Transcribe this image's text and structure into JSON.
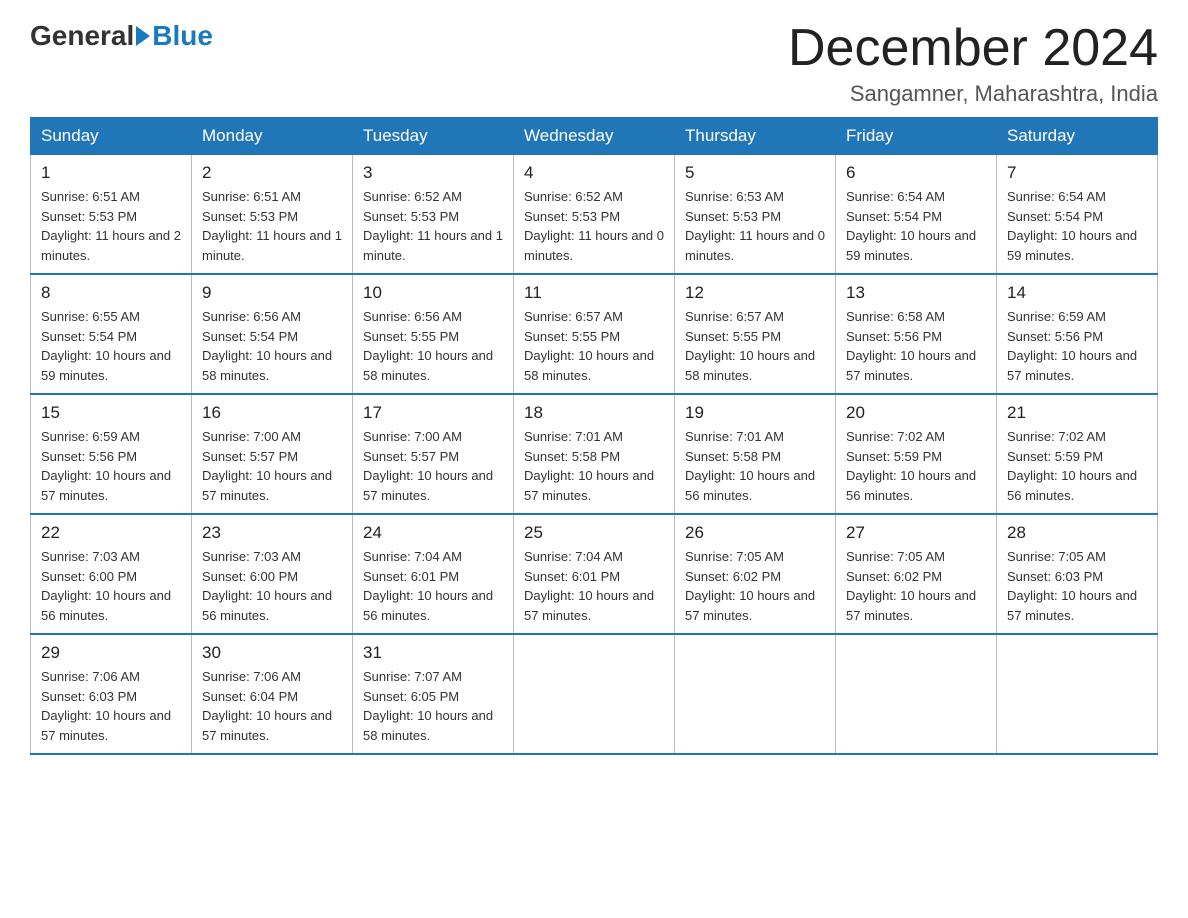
{
  "header": {
    "logo_general": "General",
    "logo_blue": "Blue",
    "month_title": "December 2024",
    "location": "Sangamner, Maharashtra, India"
  },
  "days_of_week": [
    "Sunday",
    "Monday",
    "Tuesday",
    "Wednesday",
    "Thursday",
    "Friday",
    "Saturday"
  ],
  "weeks": [
    [
      {
        "num": "1",
        "sunrise": "6:51 AM",
        "sunset": "5:53 PM",
        "daylight": "11 hours and 2 minutes."
      },
      {
        "num": "2",
        "sunrise": "6:51 AM",
        "sunset": "5:53 PM",
        "daylight": "11 hours and 1 minute."
      },
      {
        "num": "3",
        "sunrise": "6:52 AM",
        "sunset": "5:53 PM",
        "daylight": "11 hours and 1 minute."
      },
      {
        "num": "4",
        "sunrise": "6:52 AM",
        "sunset": "5:53 PM",
        "daylight": "11 hours and 0 minutes."
      },
      {
        "num": "5",
        "sunrise": "6:53 AM",
        "sunset": "5:53 PM",
        "daylight": "11 hours and 0 minutes."
      },
      {
        "num": "6",
        "sunrise": "6:54 AM",
        "sunset": "5:54 PM",
        "daylight": "10 hours and 59 minutes."
      },
      {
        "num": "7",
        "sunrise": "6:54 AM",
        "sunset": "5:54 PM",
        "daylight": "10 hours and 59 minutes."
      }
    ],
    [
      {
        "num": "8",
        "sunrise": "6:55 AM",
        "sunset": "5:54 PM",
        "daylight": "10 hours and 59 minutes."
      },
      {
        "num": "9",
        "sunrise": "6:56 AM",
        "sunset": "5:54 PM",
        "daylight": "10 hours and 58 minutes."
      },
      {
        "num": "10",
        "sunrise": "6:56 AM",
        "sunset": "5:55 PM",
        "daylight": "10 hours and 58 minutes."
      },
      {
        "num": "11",
        "sunrise": "6:57 AM",
        "sunset": "5:55 PM",
        "daylight": "10 hours and 58 minutes."
      },
      {
        "num": "12",
        "sunrise": "6:57 AM",
        "sunset": "5:55 PM",
        "daylight": "10 hours and 58 minutes."
      },
      {
        "num": "13",
        "sunrise": "6:58 AM",
        "sunset": "5:56 PM",
        "daylight": "10 hours and 57 minutes."
      },
      {
        "num": "14",
        "sunrise": "6:59 AM",
        "sunset": "5:56 PM",
        "daylight": "10 hours and 57 minutes."
      }
    ],
    [
      {
        "num": "15",
        "sunrise": "6:59 AM",
        "sunset": "5:56 PM",
        "daylight": "10 hours and 57 minutes."
      },
      {
        "num": "16",
        "sunrise": "7:00 AM",
        "sunset": "5:57 PM",
        "daylight": "10 hours and 57 minutes."
      },
      {
        "num": "17",
        "sunrise": "7:00 AM",
        "sunset": "5:57 PM",
        "daylight": "10 hours and 57 minutes."
      },
      {
        "num": "18",
        "sunrise": "7:01 AM",
        "sunset": "5:58 PM",
        "daylight": "10 hours and 57 minutes."
      },
      {
        "num": "19",
        "sunrise": "7:01 AM",
        "sunset": "5:58 PM",
        "daylight": "10 hours and 56 minutes."
      },
      {
        "num": "20",
        "sunrise": "7:02 AM",
        "sunset": "5:59 PM",
        "daylight": "10 hours and 56 minutes."
      },
      {
        "num": "21",
        "sunrise": "7:02 AM",
        "sunset": "5:59 PM",
        "daylight": "10 hours and 56 minutes."
      }
    ],
    [
      {
        "num": "22",
        "sunrise": "7:03 AM",
        "sunset": "6:00 PM",
        "daylight": "10 hours and 56 minutes."
      },
      {
        "num": "23",
        "sunrise": "7:03 AM",
        "sunset": "6:00 PM",
        "daylight": "10 hours and 56 minutes."
      },
      {
        "num": "24",
        "sunrise": "7:04 AM",
        "sunset": "6:01 PM",
        "daylight": "10 hours and 56 minutes."
      },
      {
        "num": "25",
        "sunrise": "7:04 AM",
        "sunset": "6:01 PM",
        "daylight": "10 hours and 57 minutes."
      },
      {
        "num": "26",
        "sunrise": "7:05 AM",
        "sunset": "6:02 PM",
        "daylight": "10 hours and 57 minutes."
      },
      {
        "num": "27",
        "sunrise": "7:05 AM",
        "sunset": "6:02 PM",
        "daylight": "10 hours and 57 minutes."
      },
      {
        "num": "28",
        "sunrise": "7:05 AM",
        "sunset": "6:03 PM",
        "daylight": "10 hours and 57 minutes."
      }
    ],
    [
      {
        "num": "29",
        "sunrise": "7:06 AM",
        "sunset": "6:03 PM",
        "daylight": "10 hours and 57 minutes."
      },
      {
        "num": "30",
        "sunrise": "7:06 AM",
        "sunset": "6:04 PM",
        "daylight": "10 hours and 57 minutes."
      },
      {
        "num": "31",
        "sunrise": "7:07 AM",
        "sunset": "6:05 PM",
        "daylight": "10 hours and 58 minutes."
      },
      null,
      null,
      null,
      null
    ]
  ]
}
